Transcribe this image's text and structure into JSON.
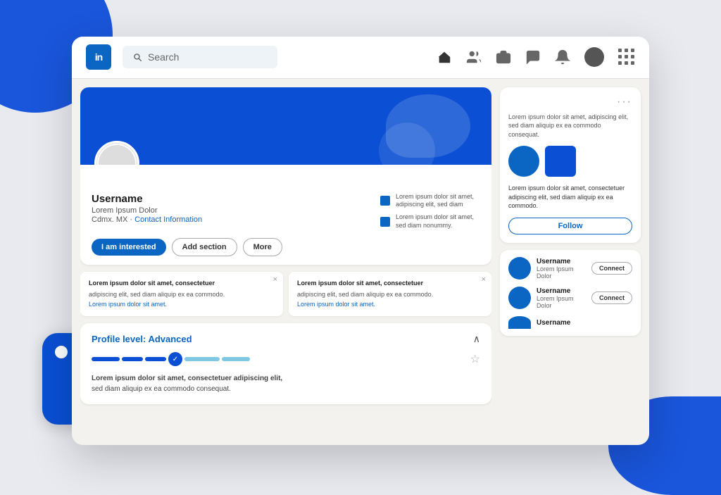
{
  "background": {
    "colors": {
      "main": "#e8eaf0",
      "linkedin_blue": "#0a4fd4",
      "linkedin_brand": "#0a66c2"
    }
  },
  "nav": {
    "logo": "in",
    "search_placeholder": "Search",
    "icons": [
      "home",
      "people",
      "briefcase",
      "chat",
      "bell",
      "avatar",
      "grid"
    ]
  },
  "profile": {
    "name": "Username",
    "title": "Lorem Ipsum Dolor",
    "location": "Cdmx. MX",
    "contact_label": "Contact Information",
    "stats": [
      {
        "text": "Lorem ipsum dolor sit amet, adipiscing elit, sed diam"
      },
      {
        "text": "Lorem ipsum dolor sit amet, sed diam nonummy."
      }
    ],
    "buttons": {
      "interested": "I am interested",
      "add_section": "Add section",
      "more": "More"
    }
  },
  "activity_cards": [
    {
      "title": "Lorem ipsum dolor sit amet, consectetuer",
      "body": "adipiscing elit, sed diam aliquip ex ea commodo.",
      "link": "Lorem ipsum dolor sit amet.",
      "close": "×"
    },
    {
      "title": "Lorem ipsum dolor sit amet, consectetuer",
      "body": "adipiscing elit, sed diam aliquip ex ea commodo.",
      "link": "Lorem ipsum dolor sit amet.",
      "close": "×"
    }
  ],
  "profile_level": {
    "label": "Profile level:",
    "level": "Advanced",
    "description": "Lorem ipsum dolor sit amet, consectetuer adipiscing elit, sed diam aliquip ex ea commodo consequat."
  },
  "sidebar": {
    "ad_card": {
      "dots": "···",
      "desc": "Lorem ipsum dolor sit amet, adipiscing elit, sed diam aliquip ex ea commodo consequat.",
      "body": "Lorem ipsum dolor sit amet, consectetuer adipiscing elit, sed diam aliquip ex ea commodo.",
      "follow_label": "Follow"
    },
    "people": [
      {
        "name": "Username",
        "title": "Lorem Ipsum Dolor",
        "action": "Connect"
      },
      {
        "name": "Username",
        "title": "Lorem Ipsum Dolor",
        "action": "Connect"
      },
      {
        "name": "Username",
        "title": "",
        "partial": true
      }
    ]
  }
}
